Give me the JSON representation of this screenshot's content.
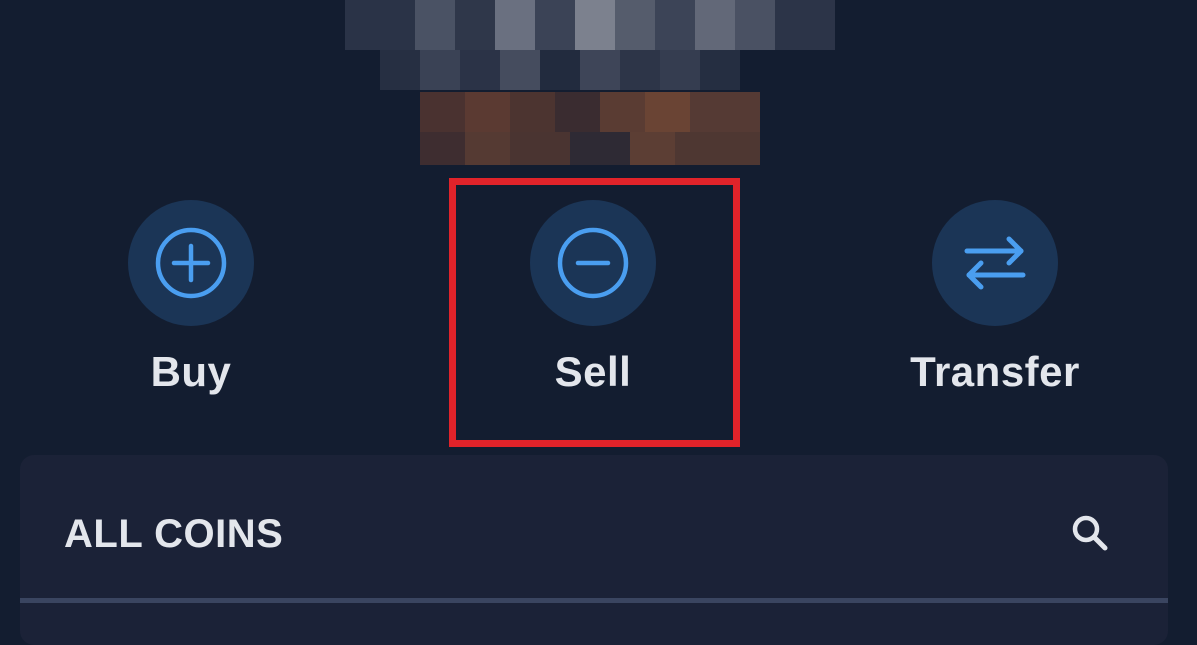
{
  "actions": {
    "buy": {
      "label": "Buy",
      "icon": "plus-circle-icon"
    },
    "sell": {
      "label": "Sell",
      "icon": "minus-circle-icon"
    },
    "transfer": {
      "label": "Transfer",
      "icon": "arrows-swap-icon"
    }
  },
  "coins": {
    "title": "ALL COINS",
    "search_icon": "search-icon"
  },
  "colors": {
    "background": "#131d30",
    "icon_circle": "#1b3556",
    "icon_stroke": "#4a9ef0",
    "highlight": "#e0232a",
    "card": "#1b2237"
  }
}
